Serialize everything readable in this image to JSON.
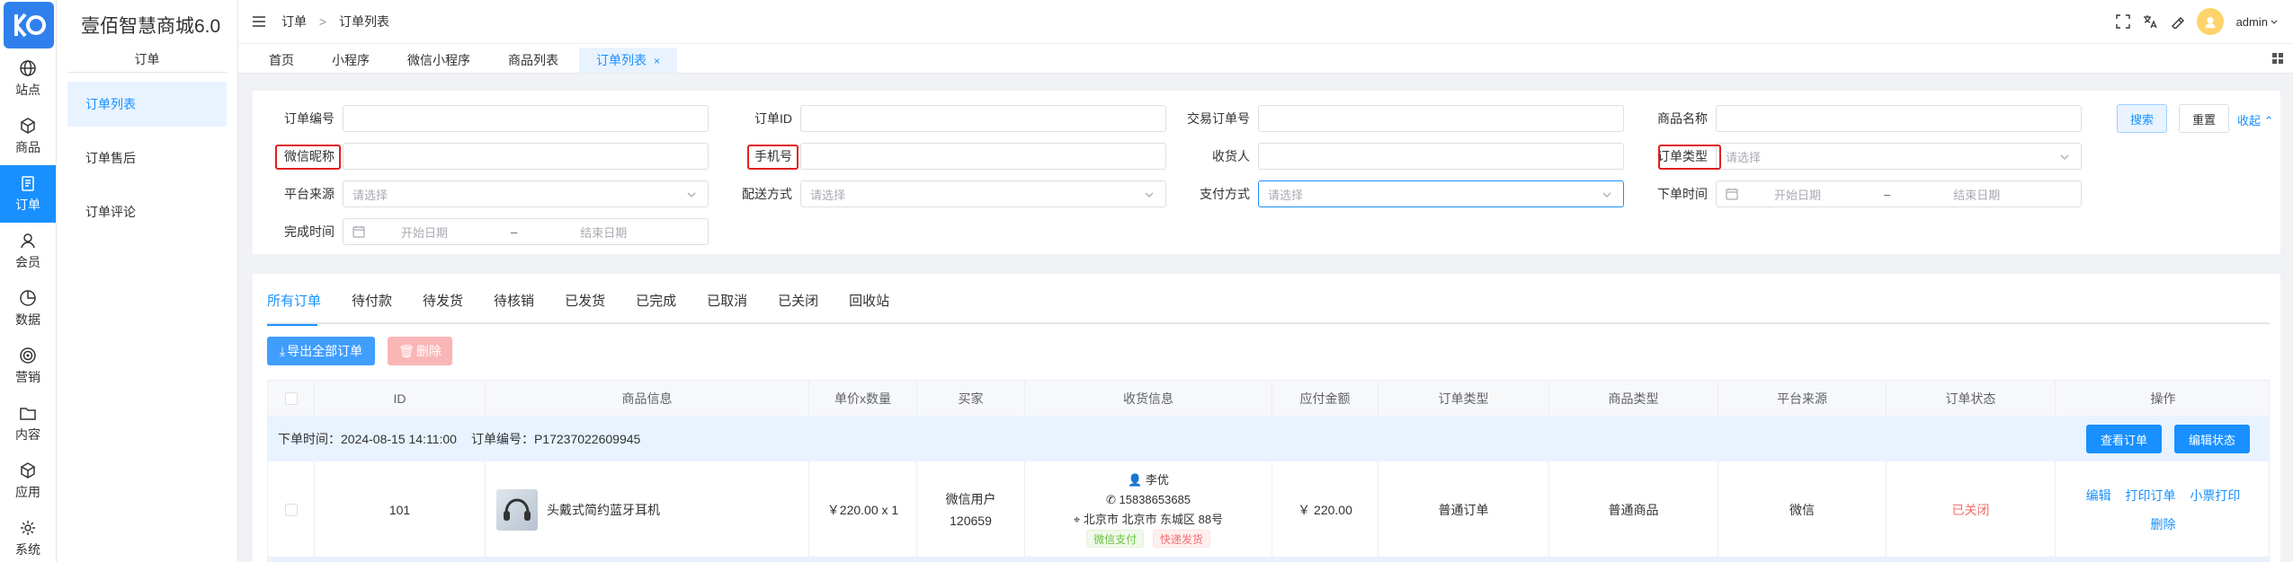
{
  "app": {
    "name": "壹佰智慧商城6.0"
  },
  "rail": [
    {
      "label": "站点",
      "icon": "globe-icon"
    },
    {
      "label": "商品",
      "icon": "box-icon"
    },
    {
      "label": "订单",
      "icon": "clipboard-icon",
      "active": true
    },
    {
      "label": "会员",
      "icon": "user-icon"
    },
    {
      "label": "数据",
      "icon": "pie-icon"
    },
    {
      "label": "营销",
      "icon": "target-icon"
    },
    {
      "label": "内容",
      "icon": "folder-icon"
    },
    {
      "label": "应用",
      "icon": "cube-icon"
    },
    {
      "label": "系统",
      "icon": "gear-icon"
    }
  ],
  "submenu": {
    "title": "订单",
    "items": [
      "订单列表",
      "订单售后",
      "订单评论"
    ]
  },
  "breadcrumb": {
    "root": "订单",
    "sep": ">",
    "current": "订单列表"
  },
  "user": {
    "name": "admin"
  },
  "tabs": [
    "首页",
    "小程序",
    "微信小程序",
    "商品列表",
    "订单列表"
  ],
  "tab_close": "×",
  "filter": {
    "order_no": "订单编号",
    "order_id": "订单ID",
    "trade_no": "交易订单号",
    "goods_name": "商品名称",
    "wx_nick": "微信昵称",
    "phone": "手机号",
    "receiver": "收货人",
    "order_type": "订单类型",
    "platform": "平台来源",
    "delivery": "配送方式",
    "payment": "支付方式",
    "order_time": "下单时间",
    "finish_time": "完成时间",
    "select_placeholder": "请选择",
    "start_date": "开始日期",
    "end_date": "结束日期",
    "range_sep": "–",
    "search": "搜索",
    "reset": "重置",
    "collapse": "收起"
  },
  "order_tabs": [
    "所有订单",
    "待付款",
    "待发货",
    "待核销",
    "已发货",
    "已完成",
    "已取消",
    "已关闭",
    "回收站"
  ],
  "actions": {
    "export": "导出全部订单",
    "delete": "删除"
  },
  "table": {
    "headers": [
      "ID",
      "商品信息",
      "单价x数量",
      "买家",
      "收货信息",
      "应付金额",
      "订单类型",
      "商品类型",
      "平台来源",
      "订单状态",
      "操作"
    ],
    "group": {
      "time_label": "下单时间：",
      "time": "2024-08-15 14:11:00",
      "no_label": "订单编号：",
      "no": "P17237022609945",
      "view_btn": "查看订单",
      "edit_btn": "编辑状态"
    },
    "row": {
      "id": "101",
      "goods": "头戴式简约蓝牙耳机",
      "price_qty": "￥220.00 x 1",
      "buyer_line1": "微信用户",
      "buyer_line2": "120659",
      "receiver_name": "李优",
      "receiver_phone": "15838653685",
      "receiver_addr": "北京市 北京市 东城区 88号",
      "pay_tag": "微信支付",
      "ship_tag": "快递发货",
      "amount": "￥ 220.00",
      "order_type": "普通订单",
      "goods_type": "普通商品",
      "platform": "微信",
      "status": "已关闭",
      "op_edit": "编辑",
      "op_print": "打印订单",
      "op_receipt": "小票打印",
      "op_delete": "删除"
    }
  },
  "colors": {
    "primary": "#1890ff",
    "danger": "#f56c6c",
    "highlight": "#e02020"
  }
}
